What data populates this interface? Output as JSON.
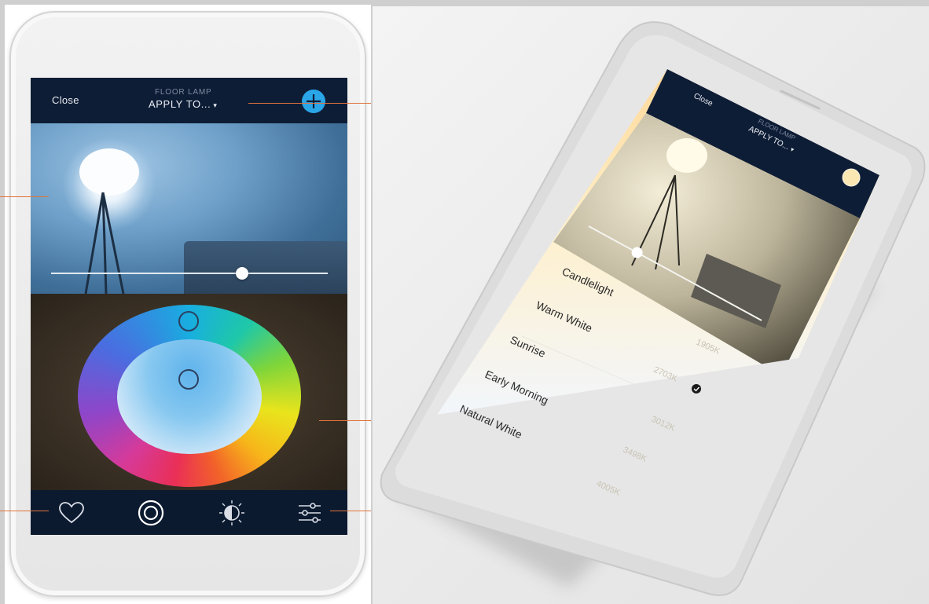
{
  "left_phone": {
    "topbar": {
      "close_label": "Close",
      "device_label": "FLOOR LAMP",
      "apply_label": "APPLY TO...",
      "apply_caret": "▾"
    },
    "add_icon": "plus-icon",
    "brightness_level": 0.69,
    "bottom_nav": [
      {
        "icon": "heart-icon"
      },
      {
        "icon": "color-wheel-icon"
      },
      {
        "icon": "scene-icon"
      },
      {
        "icon": "sliders-icon"
      }
    ]
  },
  "right_phone": {
    "topbar": {
      "close_label": "Close",
      "device_label": "FLOOR LAMP",
      "apply_label": "APPLY TO...",
      "apply_caret": "▾"
    },
    "brightness_level": 0.28,
    "presets": [
      {
        "name": "Candlelight",
        "temp": ""
      },
      {
        "name": "Warm White",
        "temp": "1905K"
      },
      {
        "name": "Sunrise",
        "temp": "2703K",
        "selected": true
      },
      {
        "name": "Early Morning",
        "temp": "3012K"
      },
      {
        "name": "Natural White",
        "temp": "3498K"
      },
      {
        "name": "",
        "temp": "4005K"
      }
    ]
  },
  "colors": {
    "accent_blue": "#2aa6e8",
    "callout_orange": "#e2733b",
    "screen_navy": "#0e1d36"
  }
}
